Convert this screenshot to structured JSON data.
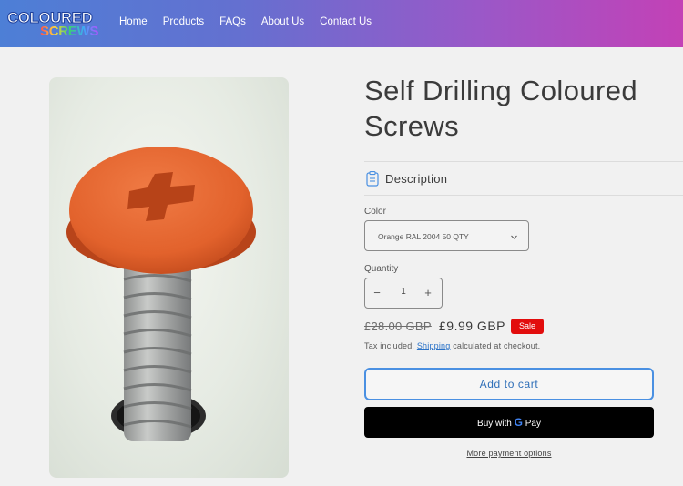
{
  "header": {
    "logo_top": "COLOURED",
    "logo_bottom": "SCREWS",
    "nav": [
      "Home",
      "Products",
      "FAQs",
      "About Us",
      "Contact Us"
    ]
  },
  "product": {
    "title": "Self Drilling Coloured Screws",
    "description_label": "Description",
    "color_label": "Color",
    "color_value": "Orange RAL 2004 50 QTY",
    "quantity_label": "Quantity",
    "quantity_value": "1",
    "price_old": "£28.00 GBP",
    "price_new": "£9.99 GBP",
    "badge": "Sale",
    "tax_prefix": "Tax included.",
    "tax_link": "Shipping",
    "tax_suffix": "calculated at checkout.",
    "add_to_cart": "Add to cart",
    "buy_with": "Buy with",
    "gpay_pay": "Pay",
    "more_options": "More payment options"
  },
  "colors": {
    "accent": "#4a90e2",
    "sale": "#e20d0d",
    "screw_head": "#e86a35"
  }
}
